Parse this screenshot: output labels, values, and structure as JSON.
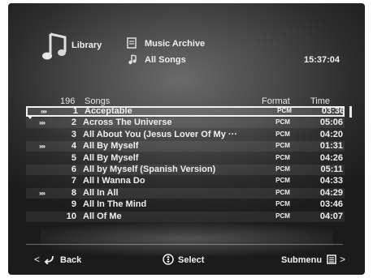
{
  "header": {
    "library_label": "Library",
    "archive_label": "Music Archive",
    "songs_label": "All Songs",
    "clock": "15:37:04"
  },
  "list_header": {
    "count": "196",
    "songs": "Songs",
    "format": "Format",
    "time": "Time"
  },
  "songs": [
    {
      "marker": "»»",
      "num": "1",
      "title": "Acceptable",
      "format": "PCM",
      "time": "03:36",
      "selected": true
    },
    {
      "marker": "»»",
      "num": "2",
      "title": "Across The Universe",
      "format": "PCM",
      "time": "05:06"
    },
    {
      "marker": "",
      "num": "3",
      "title": "All About You (Jesus Lover Of My ···",
      "format": "PCM",
      "time": "04:20"
    },
    {
      "marker": "»»",
      "num": "4",
      "title": "All By Myself",
      "format": "PCM",
      "time": "01:31"
    },
    {
      "marker": "",
      "num": "5",
      "title": "All By Myself",
      "format": "PCM",
      "time": "04:26"
    },
    {
      "marker": "",
      "num": "6",
      "title": "All by Myself (Spanish Version)",
      "format": "PCM",
      "time": "05:11"
    },
    {
      "marker": "",
      "num": "7",
      "title": "All I Wanna Do",
      "format": "PCM",
      "time": "04:33"
    },
    {
      "marker": "»»",
      "num": "8",
      "title": "All In All",
      "format": "PCM",
      "time": "04:29"
    },
    {
      "marker": "",
      "num": "9",
      "title": "All In The Mind",
      "format": "PCM",
      "time": "03:46"
    },
    {
      "marker": "",
      "num": "10",
      "title": "All Of Me",
      "format": "PCM",
      "time": "04:07"
    }
  ],
  "footer": {
    "back_label": "Back",
    "select_label": "Select",
    "submenu_label": "Submenu",
    "left_chevron": "<",
    "right_chevron": ">"
  },
  "icons": {
    "library": "music-note-icon",
    "archive": "music-archive-icon",
    "songs": "all-songs-icon",
    "back": "back-arrow-icon",
    "select": "select-dpad-icon",
    "submenu": "submenu-icon"
  }
}
